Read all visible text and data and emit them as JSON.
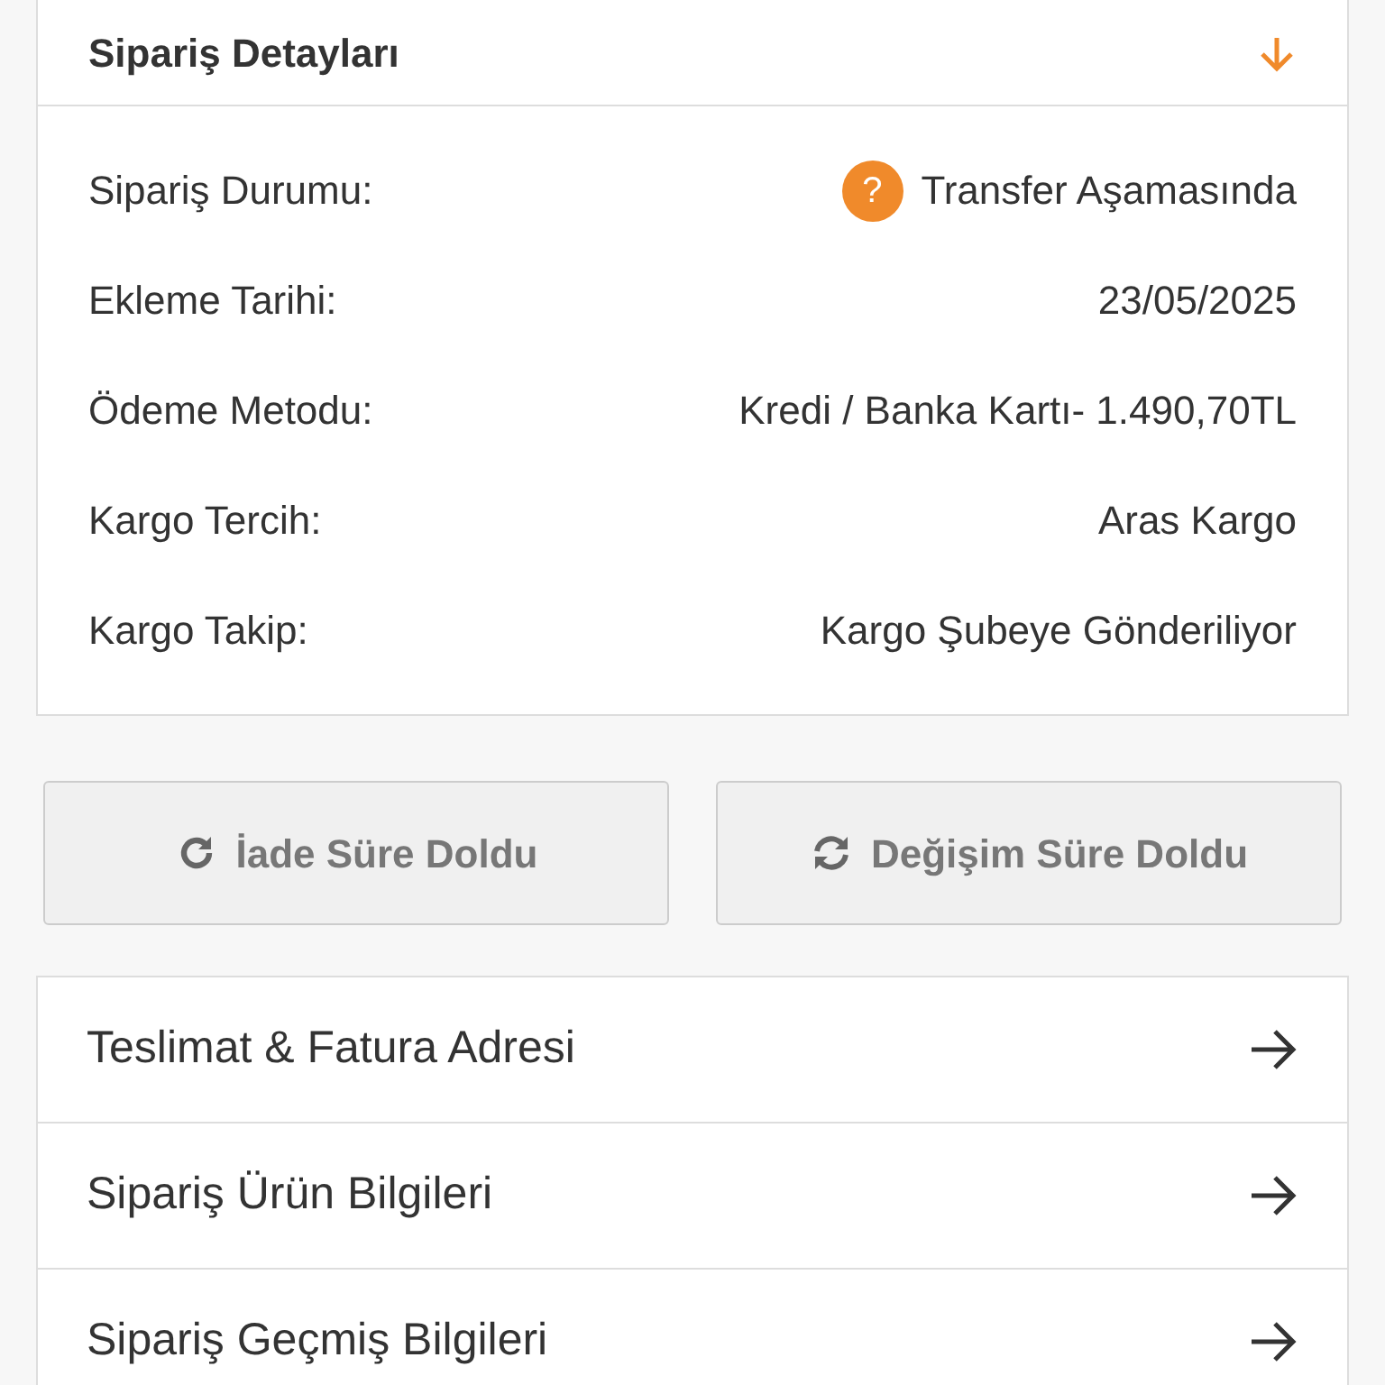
{
  "card": {
    "title": "Sipariş Detayları",
    "expanded": true,
    "rows": [
      {
        "label": "Sipariş Durumu:",
        "value": "Transfer Aşamasında",
        "badge": "?"
      },
      {
        "label": "Ekleme Tarihi:",
        "value": "23/05/2025"
      },
      {
        "label": "Ödeme Metodu:",
        "value": "Kredi / Banka Kartı- 1.490,70TL"
      },
      {
        "label": "Kargo Tercih:",
        "value": "Aras Kargo"
      },
      {
        "label": "Kargo Takip:",
        "value": "Kargo Şubeye Gönderiliyor"
      }
    ]
  },
  "buttons": [
    {
      "label": "İade Süre Doldu",
      "kind": "return",
      "disabled": true
    },
    {
      "label": "Değişim Süre Doldu",
      "kind": "exchange",
      "disabled": true
    }
  ],
  "links": [
    {
      "label": "Teslimat & Fatura Adresi"
    },
    {
      "label": "Sipariş Ürün Bilgileri"
    },
    {
      "label": "Sipariş Geçmiş Bilgileri"
    }
  ]
}
